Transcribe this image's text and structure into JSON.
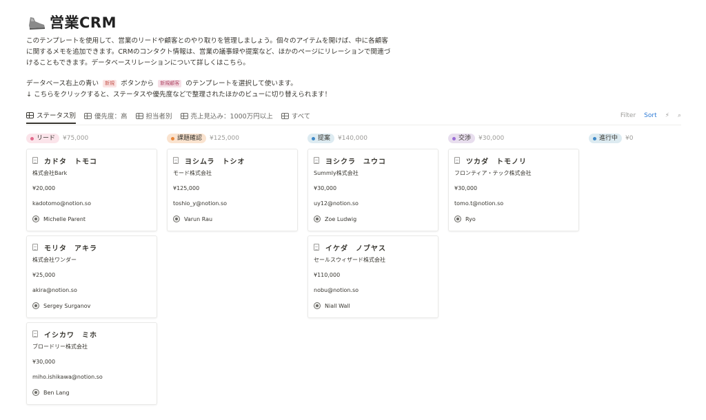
{
  "page": {
    "title": "営業CRM",
    "desc_lines": [
      "このテンプレートを使用して、営業のリードや顧客とのやり取りを管理しましょう。個々のアイテムを開けば、中に各顧客",
      "に関するメモを追加できます。CRMのコンタクト情報は、営業の議事録や提案など、ほかのページにリレーションで関連づ",
      "けることもできます。データベースリレーションについて詳しくはこちら。"
    ],
    "instruction_before": "データベース右上の青い",
    "new_tag": "新規",
    "instruction_mid": "ボタンから",
    "customer_tag": "新規顧客",
    "instruction_after": "のテンプレートを選択して使います。",
    "instruction2": "↓ こちらをクリックすると、ステータスや優先度などで整理されたほかのビューに切り替えられます！"
  },
  "tabs": [
    {
      "label": "ステータス別"
    },
    {
      "label": "優先度：高"
    },
    {
      "label": "担当者別"
    },
    {
      "label": "売上見込み：1000万円以上"
    },
    {
      "label": "すべて"
    }
  ],
  "toolbar": {
    "filter": "Filter",
    "sort": "Sort",
    "bolt": "⚡",
    "search": "⌕"
  },
  "colors": {
    "sort_blue": "#2e7bd6"
  },
  "columns": [
    {
      "label": "リード",
      "sum": "¥75,000",
      "bg": "#fbe4ea",
      "dot": "#e16b8c",
      "cards": [
        {
          "name": "カドタ　トモコ",
          "company": "株式会社Bark",
          "amount": "¥20,000",
          "email": "kadotomo@notion.so",
          "person": "Michelle Parent"
        },
        {
          "name": "モリタ　アキラ",
          "company": "株式会社ワンダー",
          "amount": "¥25,000",
          "email": "akira@notion.so",
          "person": "Sergey Surganov"
        },
        {
          "name": "イシカワ　ミホ",
          "company": "ブロードリー株式会社",
          "amount": "¥30,000",
          "email": "miho.ishikawa@notion.so",
          "person": "Ben Lang"
        }
      ]
    },
    {
      "label": "課題確認",
      "sum": "¥125,000",
      "bg": "#fae3cf",
      "dot": "#e8863a",
      "cards": [
        {
          "name": "ヨシムラ　トシオ",
          "company": "モード株式会社",
          "amount": "¥125,000",
          "email": "toshio_y@notion.so",
          "person": "Varun Rau"
        }
      ]
    },
    {
      "label": "提案",
      "sum": "¥140,000",
      "bg": "#ddebf1",
      "dot": "#3f89c8",
      "cards": [
        {
          "name": "ヨシクラ　ユウコ",
          "company": "Summly株式会社",
          "amount": "¥30,000",
          "email": "uy12@notion.so",
          "person": "Zoe Ludwig"
        },
        {
          "name": "イケダ　ノブヤス",
          "company": "セールスウィザード株式会社",
          "amount": "¥110,000",
          "email": "nobu@notion.so",
          "person": "Niall Wall"
        }
      ]
    },
    {
      "label": "交渉",
      "sum": "¥30,000",
      "bg": "#e8deee",
      "dot": "#9a6dd7",
      "cards": [
        {
          "name": "ツカダ　トモノリ",
          "company": "フロンティア・テック株式会社",
          "amount": "¥30,000",
          "email": "tomo.t@notion.so",
          "person": "Ryo"
        }
      ]
    },
    {
      "label": "進行中",
      "sum": "¥0",
      "bg": "#ddebf1",
      "dot": "#3f89c8",
      "cards": []
    }
  ]
}
